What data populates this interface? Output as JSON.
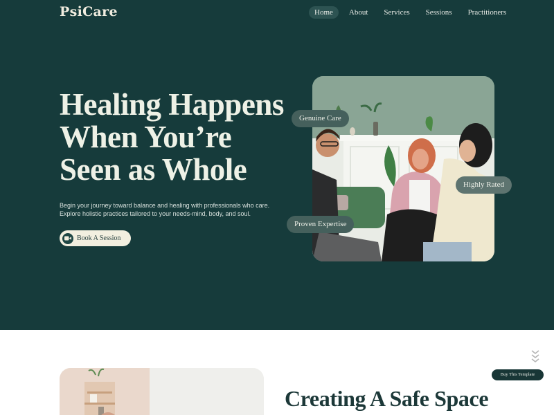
{
  "brand": {
    "name": "PsiCare"
  },
  "nav": {
    "items": [
      {
        "label": "Home",
        "active": true
      },
      {
        "label": "About"
      },
      {
        "label": "Services"
      },
      {
        "label": "Sessions"
      },
      {
        "label": "Practitioners"
      }
    ]
  },
  "hero": {
    "headline": "Healing Happens When You’re Seen as Whole",
    "subtext_line1": "Begin your journey toward balance and healing with professionals who care.",
    "subtext_line2": "Explore holistic practices tailored to your needs-mind, body, and soul.",
    "cta_label": "Book A Session",
    "cta_icon": "video-camera-icon",
    "badges": {
      "care": "Genuine Care",
      "rated": "Highly Rated",
      "expertise": "Proven Expertise"
    }
  },
  "section2": {
    "title": "Creating A Safe Space"
  },
  "buy_button": {
    "label": "Buy This Template"
  },
  "colors": {
    "hero_bg": "#163b3b",
    "cream": "#f2efe0",
    "badge": "#45605c"
  }
}
